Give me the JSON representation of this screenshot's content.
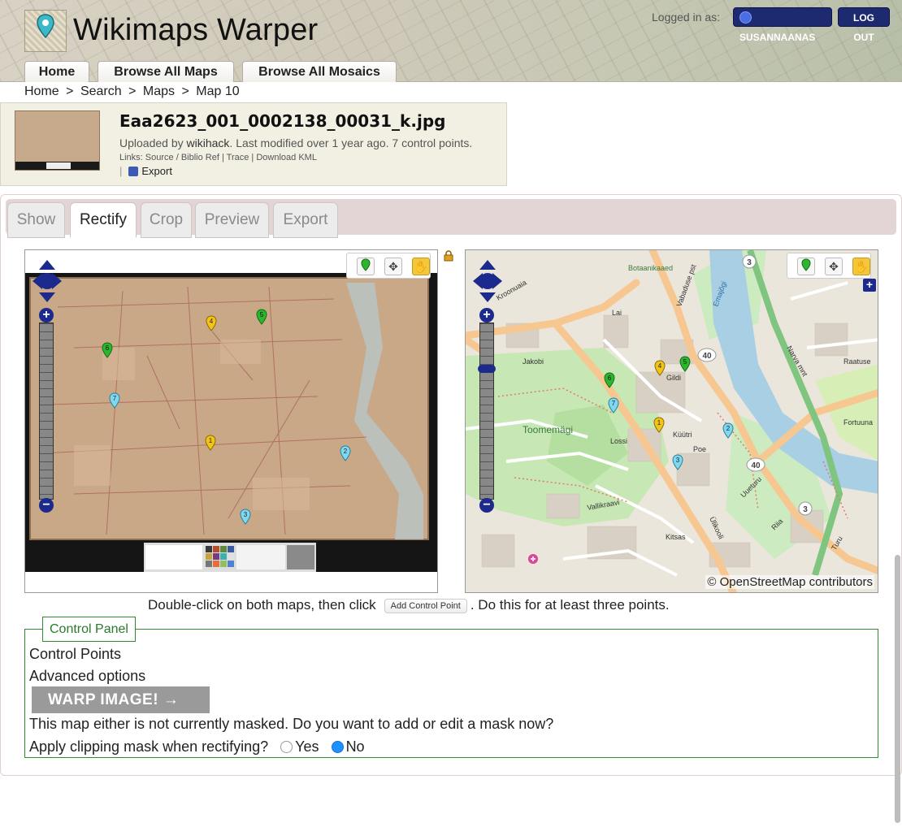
{
  "header": {
    "site_title": "Wikimaps Warper",
    "logged_in_label": "Logged in as:",
    "username": "SUSANNAANAS",
    "logout_label": "LOG OUT",
    "nav_tabs": [
      {
        "label": "Home"
      },
      {
        "label": "Browse All Maps"
      },
      {
        "label": "Browse All Mosaics"
      }
    ]
  },
  "breadcrumb": [
    "Home",
    ">",
    "Search",
    ">",
    "Maps",
    ">",
    "Map 10"
  ],
  "map_info": {
    "filename": "Eaa2623_001_0002138_00031_k.jpg",
    "uploaded_prefix": "Uploaded by",
    "uploader": "wikihack",
    "uploaded_suffix": ". Last modified over 1 year ago. 7 control points.",
    "links_text": "Links: Source / Biblio Ref | Trace | Download KML",
    "export_label": "Export"
  },
  "tabs": [
    {
      "label": "Show"
    },
    {
      "label": "Rectify"
    },
    {
      "label": "Crop"
    },
    {
      "label": "Preview"
    },
    {
      "label": "Export"
    }
  ],
  "active_tab": "Rectify",
  "right_map": {
    "attribution": "© OpenStreetMap contributors",
    "street_labels": [
      "Kroonuaia",
      "Lai",
      "Jakobi",
      "Vabaduse pst",
      "Emajõgi",
      "Narva mnt",
      "Raatuse",
      "Toomemägi",
      "Lossi",
      "Uueturu",
      "Riia",
      "Turu",
      "Küütri",
      "Poe",
      "Ülikooli",
      "Vallikraavi",
      "Kitsas",
      "Fortuuna",
      "Botaanikaaed",
      "Gildi"
    ]
  },
  "control_points": [
    "1",
    "2",
    "3",
    "4",
    "5",
    "6",
    "7"
  ],
  "instructions": {
    "before": "Double-click on both maps, then click",
    "button": "Add Control Point",
    "after": ". Do this for at least three points."
  },
  "control_panel": {
    "legend": "Control Panel",
    "control_points_label": "Control Points",
    "advanced_label": "Advanced options",
    "warp_button": "WARP IMAGE! →",
    "mask_text": "This map either is not currently masked. Do you want to add or edit a mask now?",
    "clip_question": "Apply clipping mask when rectifying?",
    "yes_label": "Yes",
    "no_label": "No",
    "clip_selected": "No"
  },
  "colors": {
    "brand_dark": "#1e2a70",
    "pin_green": "#2db52d",
    "pin_yellow": "#f2c419",
    "pin_cyan": "#7fd8f0",
    "panel_green": "#2e8b2e"
  }
}
